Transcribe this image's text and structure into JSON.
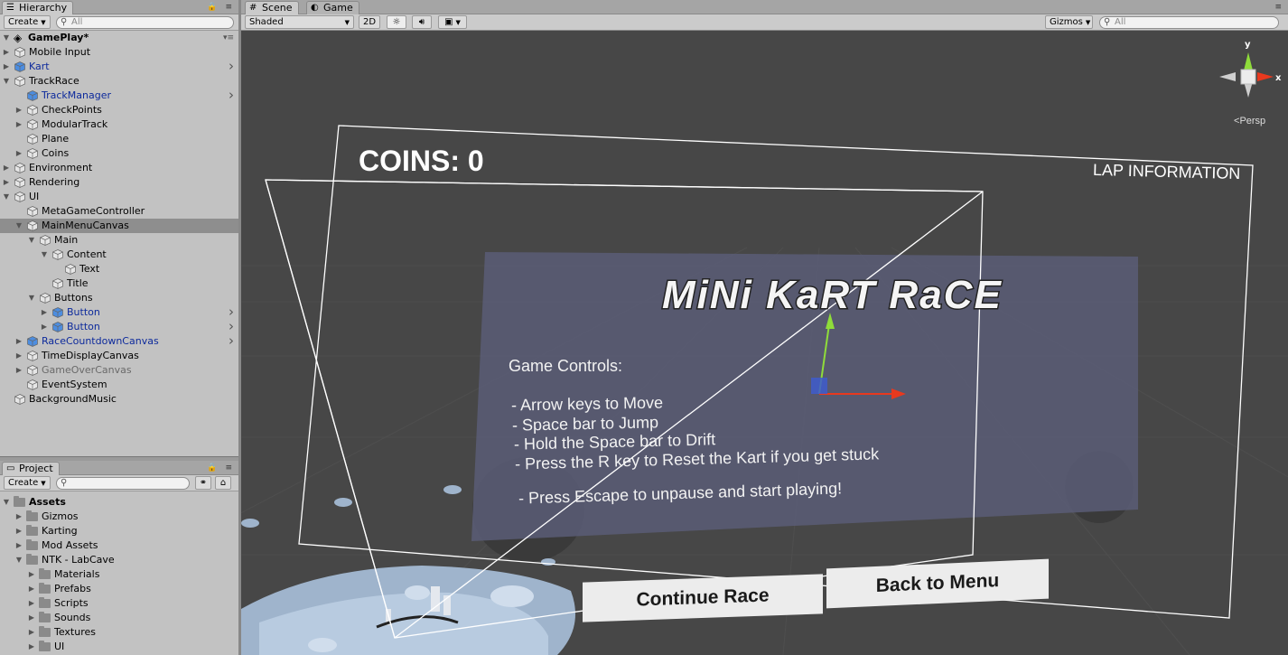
{
  "hierarchy": {
    "tab_label": "Hierarchy",
    "create_label": "Create",
    "search_placeholder": "All",
    "scene_name": "GamePlay*",
    "items": [
      {
        "label": "Mobile Input",
        "depth": 1,
        "fold": "closed",
        "style": "normal"
      },
      {
        "label": "Kart",
        "depth": 1,
        "fold": "closed",
        "style": "prefab",
        "chevron": true
      },
      {
        "label": "TrackRace",
        "depth": 1,
        "fold": "open",
        "style": "normal"
      },
      {
        "label": "TrackManager",
        "depth": 2,
        "fold": "none",
        "style": "prefab",
        "chevron": true
      },
      {
        "label": "CheckPoints",
        "depth": 2,
        "fold": "closed",
        "style": "normal"
      },
      {
        "label": "ModularTrack",
        "depth": 2,
        "fold": "closed",
        "style": "normal"
      },
      {
        "label": "Plane",
        "depth": 2,
        "fold": "none",
        "style": "normal"
      },
      {
        "label": "Coins",
        "depth": 2,
        "fold": "closed",
        "style": "normal"
      },
      {
        "label": "Environment",
        "depth": 1,
        "fold": "closed",
        "style": "normal"
      },
      {
        "label": "Rendering",
        "depth": 1,
        "fold": "closed",
        "style": "normal"
      },
      {
        "label": "UI",
        "depth": 1,
        "fold": "open",
        "style": "normal"
      },
      {
        "label": "MetaGameController",
        "depth": 2,
        "fold": "none",
        "style": "normal"
      },
      {
        "label": "MainMenuCanvas",
        "depth": 2,
        "fold": "open",
        "style": "normal",
        "selected": true
      },
      {
        "label": "Main",
        "depth": 3,
        "fold": "open",
        "style": "normal"
      },
      {
        "label": "Content",
        "depth": 4,
        "fold": "open",
        "style": "normal"
      },
      {
        "label": "Text",
        "depth": 5,
        "fold": "none",
        "style": "normal"
      },
      {
        "label": "Title",
        "depth": 4,
        "fold": "none",
        "style": "normal"
      },
      {
        "label": "Buttons",
        "depth": 3,
        "fold": "open",
        "style": "normal"
      },
      {
        "label": "Button",
        "depth": 4,
        "fold": "closed",
        "style": "prefab",
        "chevron": true
      },
      {
        "label": "Button",
        "depth": 4,
        "fold": "closed",
        "style": "prefab",
        "chevron": true
      },
      {
        "label": "RaceCountdownCanvas",
        "depth": 2,
        "fold": "closed",
        "style": "prefab",
        "chevron": true
      },
      {
        "label": "TimeDisplayCanvas",
        "depth": 2,
        "fold": "closed",
        "style": "normal"
      },
      {
        "label": "GameOverCanvas",
        "depth": 2,
        "fold": "closed",
        "style": "inactive"
      },
      {
        "label": "EventSystem",
        "depth": 2,
        "fold": "none",
        "style": "normal"
      },
      {
        "label": "BackgroundMusic",
        "depth": 1,
        "fold": "none",
        "style": "normal"
      }
    ]
  },
  "project": {
    "tab_label": "Project",
    "create_label": "Create",
    "search_placeholder": "",
    "root": "Assets",
    "items": [
      {
        "label": "Gizmos",
        "depth": 1,
        "fold": "closed"
      },
      {
        "label": "Karting",
        "depth": 1,
        "fold": "closed"
      },
      {
        "label": "Mod Assets",
        "depth": 1,
        "fold": "closed"
      },
      {
        "label": "NTK - LabCave",
        "depth": 1,
        "fold": "open"
      },
      {
        "label": "Materials",
        "depth": 2,
        "fold": "closed"
      },
      {
        "label": "Prefabs",
        "depth": 2,
        "fold": "closed"
      },
      {
        "label": "Scripts",
        "depth": 2,
        "fold": "closed"
      },
      {
        "label": "Sounds",
        "depth": 2,
        "fold": "closed"
      },
      {
        "label": "Textures",
        "depth": 2,
        "fold": "closed"
      },
      {
        "label": "UI",
        "depth": 2,
        "fold": "closed"
      }
    ]
  },
  "scene": {
    "tabs": [
      {
        "label": "Scene",
        "active": true,
        "icon": "grid-icon"
      },
      {
        "label": "Game",
        "active": false,
        "icon": "pacman-icon"
      }
    ],
    "shading_mode": "Shaded",
    "mode_2d": "2D",
    "gizmos_label": "Gizmos",
    "search_placeholder": "All",
    "persp_label": "Persp",
    "axis_labels": {
      "x": "x",
      "y": "y"
    },
    "coins_label": "COINS: 0",
    "lap_label": "LAP INFORMATION",
    "game_title": "MiNi KaRT RaCE",
    "controls": {
      "heading": "Game Controls:",
      "lines": [
        "- Arrow keys to Move",
        "- Space bar to Jump",
        "- Hold the Space bar to Drift",
        "- Press the R key to Reset the Kart if you get stuck"
      ],
      "footer": "- Press Escape to unpause and start playing!"
    },
    "buttons": {
      "continue": "Continue Race",
      "back": "Back to Menu"
    },
    "colors": {
      "viewport_bg": "#474747",
      "panel": "#5b5d77",
      "x_axis": "#e8391e",
      "y_axis": "#8fdc3a",
      "z_axis": "#3e5ccc"
    }
  }
}
